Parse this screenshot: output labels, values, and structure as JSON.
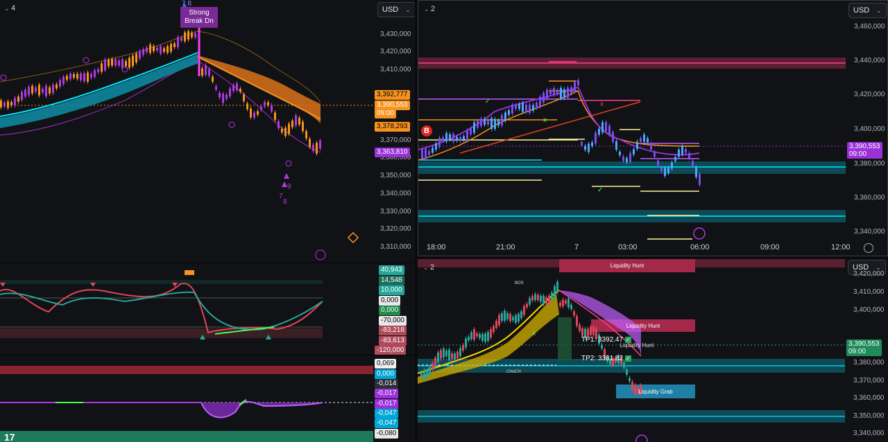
{
  "pane_top_left": {
    "count": "4",
    "currency": "USD",
    "signal_label": "Strong Break Dn",
    "signal_top": "7 8",
    "signal_nums": [
      "9",
      "7",
      "8"
    ],
    "price_axis": [
      "3,430,000",
      "3,420,000",
      "3,410,000",
      "3,370,000",
      "3,360,000",
      "3,350,000",
      "3,340,000",
      "3,330,000",
      "3,320,000",
      "3,310,000"
    ],
    "tags": [
      {
        "text": "3,392,777",
        "bg": "#f7931e",
        "fg": "#000000"
      },
      {
        "text": "3,390,553",
        "bg": "#f7931e",
        "fg": "#ffffff"
      },
      {
        "text": "09:00",
        "bg": "#f7931e",
        "fg": "#ffffff"
      },
      {
        "text": "3,378,293",
        "bg": "#f7931e",
        "fg": "#000000"
      },
      {
        "text": "3,363,810",
        "bg": "#9b30d9",
        "fg": "#ffffff"
      }
    ]
  },
  "pane_top_right": {
    "count": "2",
    "currency": "USD",
    "price_axis": [
      "3,460,000",
      "3,440,000",
      "3,420,000",
      "3,400,000",
      "3,380,000",
      "3,360,000",
      "3,340,000"
    ],
    "time_axis": [
      "18:00",
      "21:00",
      "7",
      "03:00",
      "06:00",
      "09:00",
      "12:00"
    ],
    "last_price": "3,390,553",
    "last_time": "09:00",
    "buy_marker": "B"
  },
  "pane_mid_left": {
    "tags": [
      {
        "text": "40,943",
        "bg": "#26a69a",
        "fg": "#ffffff"
      },
      {
        "text": "14,548",
        "bg": "#1d6b5a",
        "fg": "#ffffff"
      },
      {
        "text": "10,000",
        "bg": "#26a69a",
        "fg": "#ffffff"
      },
      {
        "text": "0,000",
        "bg": "#e8e8e8",
        "fg": "#000000"
      },
      {
        "text": "0,000",
        "bg": "#1f8a4c",
        "fg": "#ffffff"
      },
      {
        "text": "-70,000",
        "bg": "#e8e8e8",
        "fg": "#000000"
      },
      {
        "text": "-83,218",
        "bg": "#b04a5a",
        "fg": "#ffffff"
      },
      {
        "text": "-83,613",
        "bg": "#b04a5a",
        "fg": "#ffffff"
      },
      {
        "text": "-120,000",
        "bg": "#b04a5a",
        "fg": "#ffffff"
      }
    ]
  },
  "pane_bottom_left": {
    "tags": [
      {
        "text": "0,069",
        "bg": "#f0f0f0",
        "fg": "#000000"
      },
      {
        "text": "0,000",
        "bg": "#00a6d6",
        "fg": "#ffffff"
      },
      {
        "text": "-0,014",
        "bg": "#2a2d35",
        "fg": "#ffffff"
      },
      {
        "text": "-0,017",
        "bg": "#9b30d9",
        "fg": "#ffffff"
      },
      {
        "text": "-0,017",
        "bg": "#9b30d9",
        "fg": "#ffffff"
      },
      {
        "text": "-0,047",
        "bg": "#00a6d6",
        "fg": "#ffffff"
      },
      {
        "text": "-0,047",
        "bg": "#00a6d6",
        "fg": "#ffffff"
      },
      {
        "text": "-0,080",
        "bg": "#e8e8e8",
        "fg": "#000000"
      }
    ]
  },
  "pane_bottom_right": {
    "count": "2",
    "currency": "USD",
    "price_axis": [
      "3,420,000",
      "3,410,000",
      "3,400,000",
      "3,380,000",
      "3,370,000",
      "3,360,000",
      "3,350,000",
      "3,340,000"
    ],
    "last_price": "3,390,553",
    "last_time": "09:00",
    "zones": {
      "hunt_top": "Liquidity Hunt",
      "hunt_mid": "Liquidity Hunt",
      "hunt_small": "Liquidity Hunt",
      "grab": "Liquidity Grab"
    },
    "tp1": "TP1: 3392.47",
    "tp2": "TP2: 3381.82",
    "bos": "BOS",
    "choch": "CHoCH"
  },
  "colors": {
    "bg": "#111215",
    "up": "#26a69a",
    "down": "#ef5350",
    "cyan": "#00e5ff",
    "orange": "#f7931e",
    "purple": "#b03ae0",
    "pink": "#ff3f8e"
  }
}
